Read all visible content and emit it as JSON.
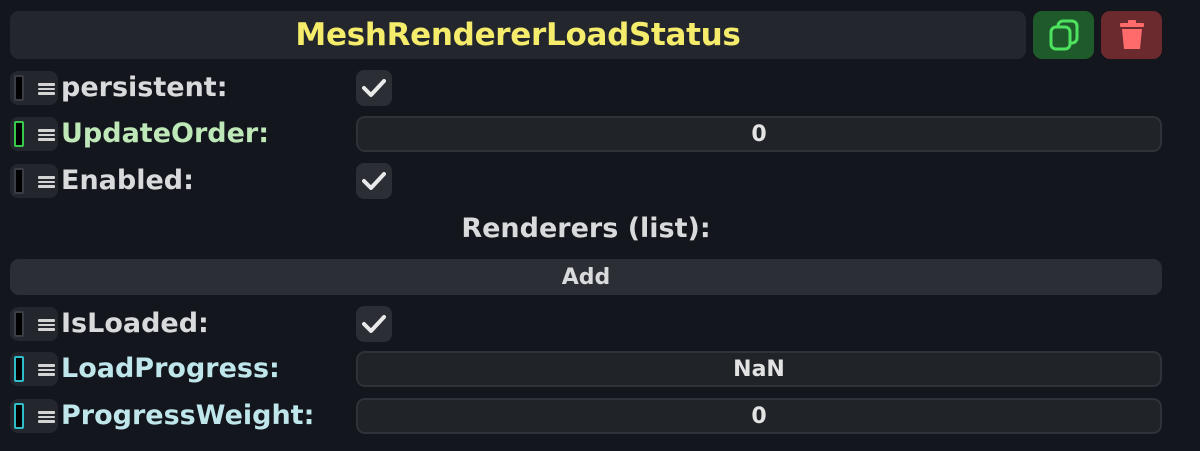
{
  "header": {
    "title": "MeshRendererLoadStatus",
    "copy_icon": "copy-icon",
    "delete_icon": "trash-icon",
    "colors": {
      "title": "#f5ec6b",
      "copy_bg": "#1f5a2a",
      "delete_bg": "#6a2a2e"
    }
  },
  "fields": {
    "persistent": {
      "label": "persistent:",
      "checked": true
    },
    "update_order": {
      "label": "UpdateOrder:",
      "value": "0"
    },
    "enabled": {
      "label": "Enabled:",
      "checked": true
    }
  },
  "renderers": {
    "title": "Renderers (list):",
    "add_label": "Add"
  },
  "status": {
    "is_loaded": {
      "label": "IsLoaded:",
      "checked": true
    },
    "load_progress": {
      "label": "LoadProgress:",
      "value": "NaN"
    },
    "progress_weight": {
      "label": "ProgressWeight:",
      "value": "0"
    }
  }
}
